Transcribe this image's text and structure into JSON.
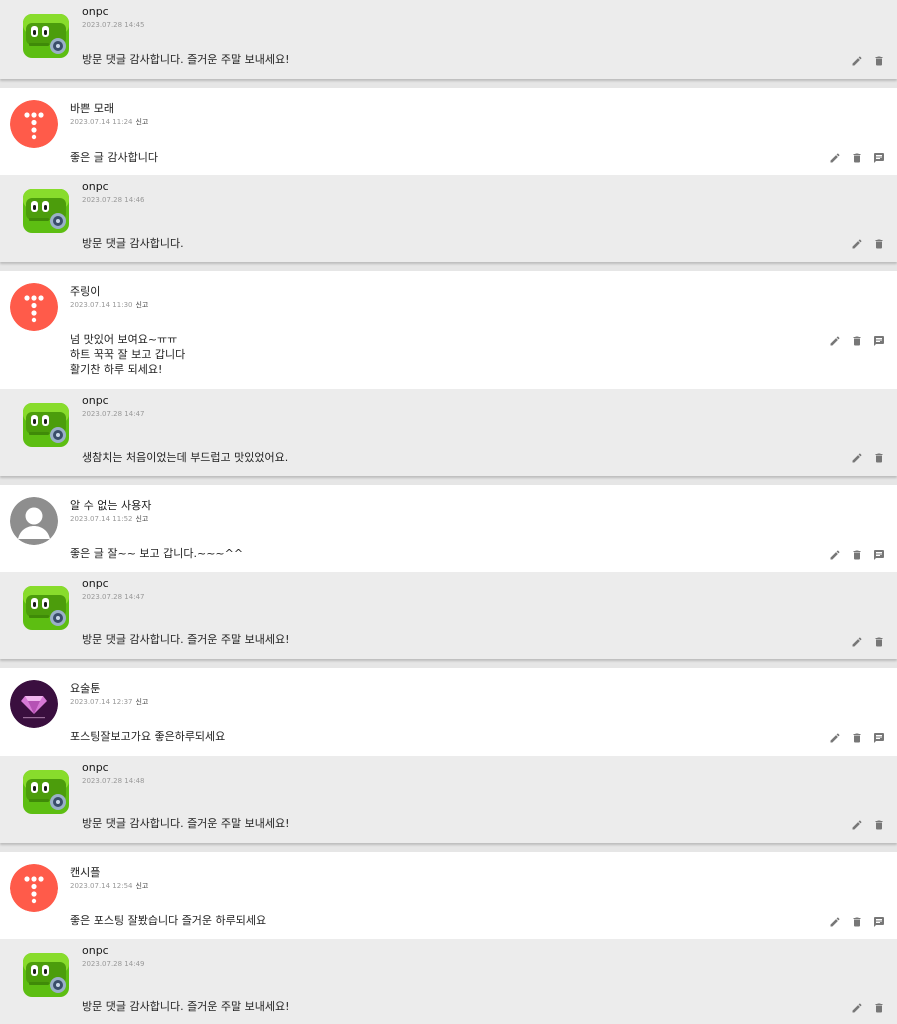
{
  "report_label": "신고",
  "icons": {
    "edit": "pencil-icon",
    "delete": "trash-icon",
    "reply": "reply-bubble-icon"
  },
  "colors": {
    "comment_bg": "#ffffff",
    "reply_bg": "#ececec",
    "default_avatar": "#ff5b4a"
  },
  "threads": [
    {
      "comment": null,
      "reply": {
        "author": "onpc",
        "date": "2023.07.28 14:45",
        "text": "방문 댓글 감사합니다. 즐거운 주말 보내세요!"
      }
    },
    {
      "comment": {
        "author": "바쁜 모래",
        "date": "2023.07.14 11:24",
        "text": "좋은 글 감사합니다",
        "avatar": "red-dots"
      },
      "reply": {
        "author": "onpc",
        "date": "2023.07.28 14:46",
        "text": "방문 댓글 감사합니다."
      }
    },
    {
      "comment": {
        "author": "주링이",
        "date": "2023.07.14 11:30",
        "text": "넘 맛있어 보여요~ㅠㅠ\n하트 꾹꾹 잘 보고 갑니다\n활기찬 하루 되세요!",
        "avatar": "red-dots"
      },
      "reply": {
        "author": "onpc",
        "date": "2023.07.28 14:47",
        "text": "생참치는 처음이었는데 부드럽고 맛있었어요."
      }
    },
    {
      "comment": {
        "author": "알 수 없는 사용자",
        "date": "2023.07.14 11:52",
        "text": "좋은 글 잘~~ 보고 갑니다.~~~^^",
        "avatar": "unknown-user"
      },
      "reply": {
        "author": "onpc",
        "date": "2023.07.28 14:47",
        "text": "방문 댓글 감사합니다. 즐거운 주말 보내세요!"
      }
    },
    {
      "comment": {
        "author": "요술툰",
        "date": "2023.07.14 12:37",
        "text": "포스팅잘보고가요 좋은하루되세요",
        "avatar": "gem"
      },
      "reply": {
        "author": "onpc",
        "date": "2023.07.28 14:48",
        "text": "방문 댓글 감사합니다. 즐거운 주말 보내세요!"
      }
    },
    {
      "comment": {
        "author": "캔시플",
        "date": "2023.07.14 12:54",
        "text": "좋은 포스팅 잘봤습니다 즐거운 하루되세요",
        "avatar": "red-dots"
      },
      "reply": {
        "author": "onpc",
        "date": "2023.07.28 14:49",
        "text": "방문 댓글 감사합니다. 즐거운 주말 보내세요!"
      }
    }
  ]
}
